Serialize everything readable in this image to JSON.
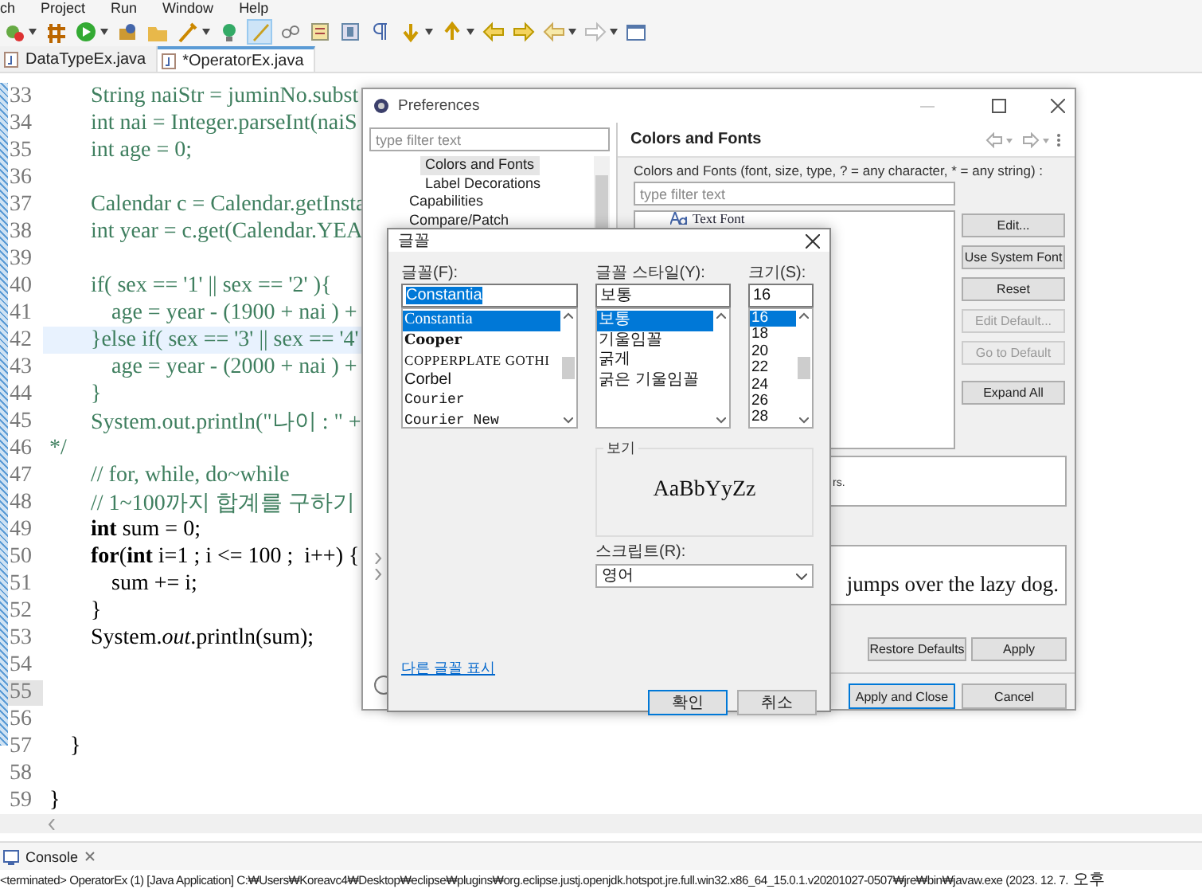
{
  "menu": [
    "ch",
    "Project",
    "Run",
    "Window",
    "Help"
  ],
  "editor_tabs": [
    {
      "label": "DataTypeEx.java",
      "selected": false
    },
    {
      "label": "*OperatorEx.java",
      "selected": true
    }
  ],
  "code_lines": [
    {
      "number": "33",
      "kind": "comment",
      "text": "\t\tString naiStr = juminNo.subst",
      "current": false
    },
    {
      "number": "34",
      "kind": "comment",
      "text": "\t\tint nai = Integer.parseInt(naiS",
      "current": false
    },
    {
      "number": "35",
      "kind": "comment",
      "text": "\t\tint age = 0;",
      "current": false
    },
    {
      "number": "36",
      "kind": "blank",
      "current": false
    },
    {
      "number": "37",
      "kind": "comment",
      "text": "\t\tCalendar c = Calendar.getInsta",
      "current": false
    },
    {
      "number": "38",
      "kind": "comment",
      "text": "\t\tint year = c.get(Calendar.YEA",
      "current": false
    },
    {
      "number": "39",
      "kind": "blank",
      "current": false
    },
    {
      "number": "40",
      "kind": "comment",
      "text": "\t\tif( sex == '1' || sex == '2' ){",
      "current": false
    },
    {
      "number": "41",
      "kind": "comment",
      "text": "\t\t\tage = year - (1900 + nai ) +",
      "current": false
    },
    {
      "number": "42",
      "kind": "comment",
      "text": "\t\t}else if( sex == '3' || sex == '4'",
      "current": false,
      "highlighted": true
    },
    {
      "number": "43",
      "kind": "comment",
      "text": "\t\t\tage = year - (2000 + nai ) +",
      "current": false
    },
    {
      "number": "44",
      "kind": "comment",
      "text": "\t\t}",
      "current": false
    },
    {
      "number": "45",
      "kind": "comment",
      "text": "\t\tSystem.out.println(\"나이 : \" +",
      "current": false
    },
    {
      "number": "46",
      "kind": "comment",
      "text": "*/",
      "current": false
    },
    {
      "number": "47",
      "kind": "comment",
      "text": "\t\t// for, while, do~while",
      "current": false
    },
    {
      "number": "48",
      "kind": "comment",
      "text": "\t\t// 1~100까지 합계를 구하기",
      "current": false
    },
    {
      "number": "49",
      "kind": "code",
      "text": "\t\t**int** sum = 0;",
      "current": false
    },
    {
      "number": "50",
      "kind": "code",
      "text": "\t\t**for**(**int** i=1 ; i <= 100 ;  i++) {",
      "current": false
    },
    {
      "number": "51",
      "kind": "code",
      "text": "\t\t\tsum += i;",
      "current": false
    },
    {
      "number": "52",
      "kind": "code",
      "text": "\t\t}",
      "current": false
    },
    {
      "number": "53",
      "kind": "code",
      "text": "\t\tSystem.*out*.println(sum);",
      "current": false
    },
    {
      "number": "54",
      "kind": "blank",
      "current": false
    },
    {
      "number": "55",
      "kind": "blank",
      "current": true
    },
    {
      "number": "56",
      "kind": "blank",
      "current": false
    },
    {
      "number": "57",
      "kind": "code",
      "text": "\t}",
      "current": false
    },
    {
      "number": "58",
      "kind": "blank",
      "current": false
    },
    {
      "number": "59",
      "kind": "code",
      "text": "}",
      "current": false
    }
  ],
  "console": {
    "tab": "Console",
    "line": "<terminated> OperatorEx (1) [Java Application] C:₩Users₩Koreavc4₩Desktop₩eclipse₩plugins₩org.eclipse.justj.openjdk.hotspot.jre.full.win32.x86_64_15.0.1.v20201027-0507₩jre₩bin₩javaw.exe  (2023. 12. 7.",
    "line_end": "오후"
  },
  "preferences": {
    "title": "Preferences",
    "filter_placeholder": "type filter text",
    "tree": [
      {
        "children": [
          {
            "label": "Colors and Fonts",
            "selected": true
          },
          {
            "label": "Label Decorations",
            "selected": false
          }
        ]
      },
      {
        "label": "Capabilities",
        "selected": false
      },
      {
        "label": "Compare/Patch",
        "selected": false
      }
    ],
    "page_title": "Colors and Fonts",
    "description": "Colors and Fonts (font, size, type, ? = any character, * = any string) :",
    "list_filter_placeholder": "type filter text",
    "list_items": [
      "Text Font"
    ],
    "side_buttons": [
      {
        "label": "Edit...",
        "disabled": false
      },
      {
        "label": "Use System Font",
        "disabled": false
      },
      {
        "label": "Reset",
        "disabled": false
      },
      {
        "label": "Edit Default...",
        "disabled": true
      },
      {
        "label": "Go to Default",
        "disabled": true
      },
      {
        "label": "Expand All",
        "disabled": false
      }
    ],
    "description_box": "rs.",
    "preview": "jumps over the lazy dog.",
    "page_buttons": [
      "Restore Defaults",
      "Apply"
    ],
    "dialog_buttons": [
      {
        "label": "Apply and Close",
        "default": true
      },
      {
        "label": "Cancel",
        "default": false
      }
    ]
  },
  "font_dialog": {
    "title": "글꼴",
    "font_label": "글꼴(F):",
    "font_value": "Constantia",
    "fonts": [
      {
        "label": "Constantia",
        "kind": "serif",
        "selected": true
      },
      {
        "label": "Cooper",
        "kind": "heavy",
        "selected": false
      },
      {
        "label": "COPPERPLATE GOTHI",
        "kind": "wide",
        "selected": false
      },
      {
        "label": "Corbel",
        "kind": "sans",
        "selected": false
      },
      {
        "label": "Courier",
        "kind": "mono",
        "selected": false
      },
      {
        "label": "Courier New",
        "kind": "mono",
        "selected": false
      }
    ],
    "style_label": "글꼴 스타일(Y):",
    "style_value": "보통",
    "styles": [
      {
        "label": "보통",
        "selected": true
      },
      {
        "label": "기울임꼴",
        "selected": false
      },
      {
        "label": "굵게",
        "selected": false
      },
      {
        "label": "굵은 기울임꼴",
        "selected": false
      }
    ],
    "size_label": "크기(S):",
    "size_value": "16",
    "sizes": [
      {
        "label": "16",
        "selected": true
      },
      {
        "label": "18",
        "selected": false
      },
      {
        "label": "20",
        "selected": false
      },
      {
        "label": "22",
        "selected": false
      },
      {
        "label": "24",
        "selected": false
      },
      {
        "label": "26",
        "selected": false
      },
      {
        "label": "28",
        "selected": false
      }
    ],
    "sample_label": "보기",
    "sample": "AaBbYyZz",
    "script_label": "스크립트(R):",
    "script_value": "영어",
    "more_link": "다른 글꼴 표시",
    "buttons": [
      {
        "label": "확인",
        "default": true
      },
      {
        "label": "취소",
        "default": false
      }
    ]
  }
}
